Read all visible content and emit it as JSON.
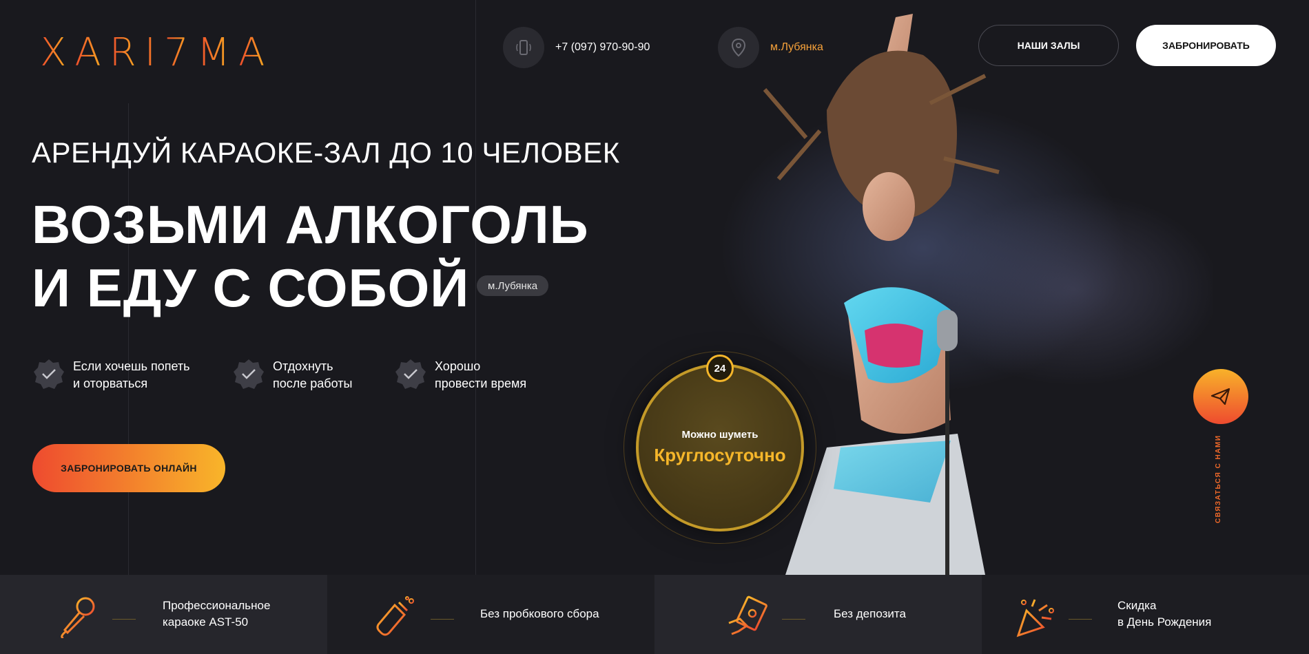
{
  "brand": {
    "logo_letters": [
      "X",
      "A",
      "R",
      "I",
      "7",
      "M",
      "A"
    ]
  },
  "header": {
    "phone": "+7 (097) 970-90-90",
    "metro": "м.Лубянка",
    "halls_button": "НАШИ ЗАЛЫ",
    "book_button": "ЗАБРОНИРОВАТЬ"
  },
  "hero": {
    "subtitle": "АРЕНДУЙ КАРАОКЕ-ЗАЛ ДО 10 ЧЕЛОВЕК",
    "headline_line1": "ВОЗЬМИ АЛКОГОЛЬ",
    "headline_line2": "И ЕДУ С СОБОЙ",
    "metro_badge": "м.Лубянка",
    "features": [
      {
        "line1": "Если хочешь попеть",
        "line2": "и оторваться"
      },
      {
        "line1": "Отдохнуть",
        "line2": "после работы"
      },
      {
        "line1": "Хорошо",
        "line2": "провести время"
      }
    ],
    "cta_button": "ЗАБРОНИРОВАТЬ ОНЛАЙН"
  },
  "badge": {
    "number": "24",
    "line1": "Можно шуметь",
    "line2": "Круглосуточно"
  },
  "side": {
    "contact_label": "СВЯЗАТЬСЯ С НАМИ"
  },
  "benefits": [
    {
      "icon": "microphone-icon",
      "line1": "Профессиональное",
      "line2": "караоке AST-50"
    },
    {
      "icon": "champagne-icon",
      "line1": "Без пробкового сбора",
      "line2": ""
    },
    {
      "icon": "money-hand-icon",
      "line1": "Без депозита",
      "line2": ""
    },
    {
      "icon": "party-popper-icon",
      "line1": "Скидка",
      "line2": "в День Рождения"
    }
  ],
  "colors": {
    "accent_orange": "#ee4b2f",
    "accent_yellow": "#f8b52a",
    "background": "#19191e"
  }
}
